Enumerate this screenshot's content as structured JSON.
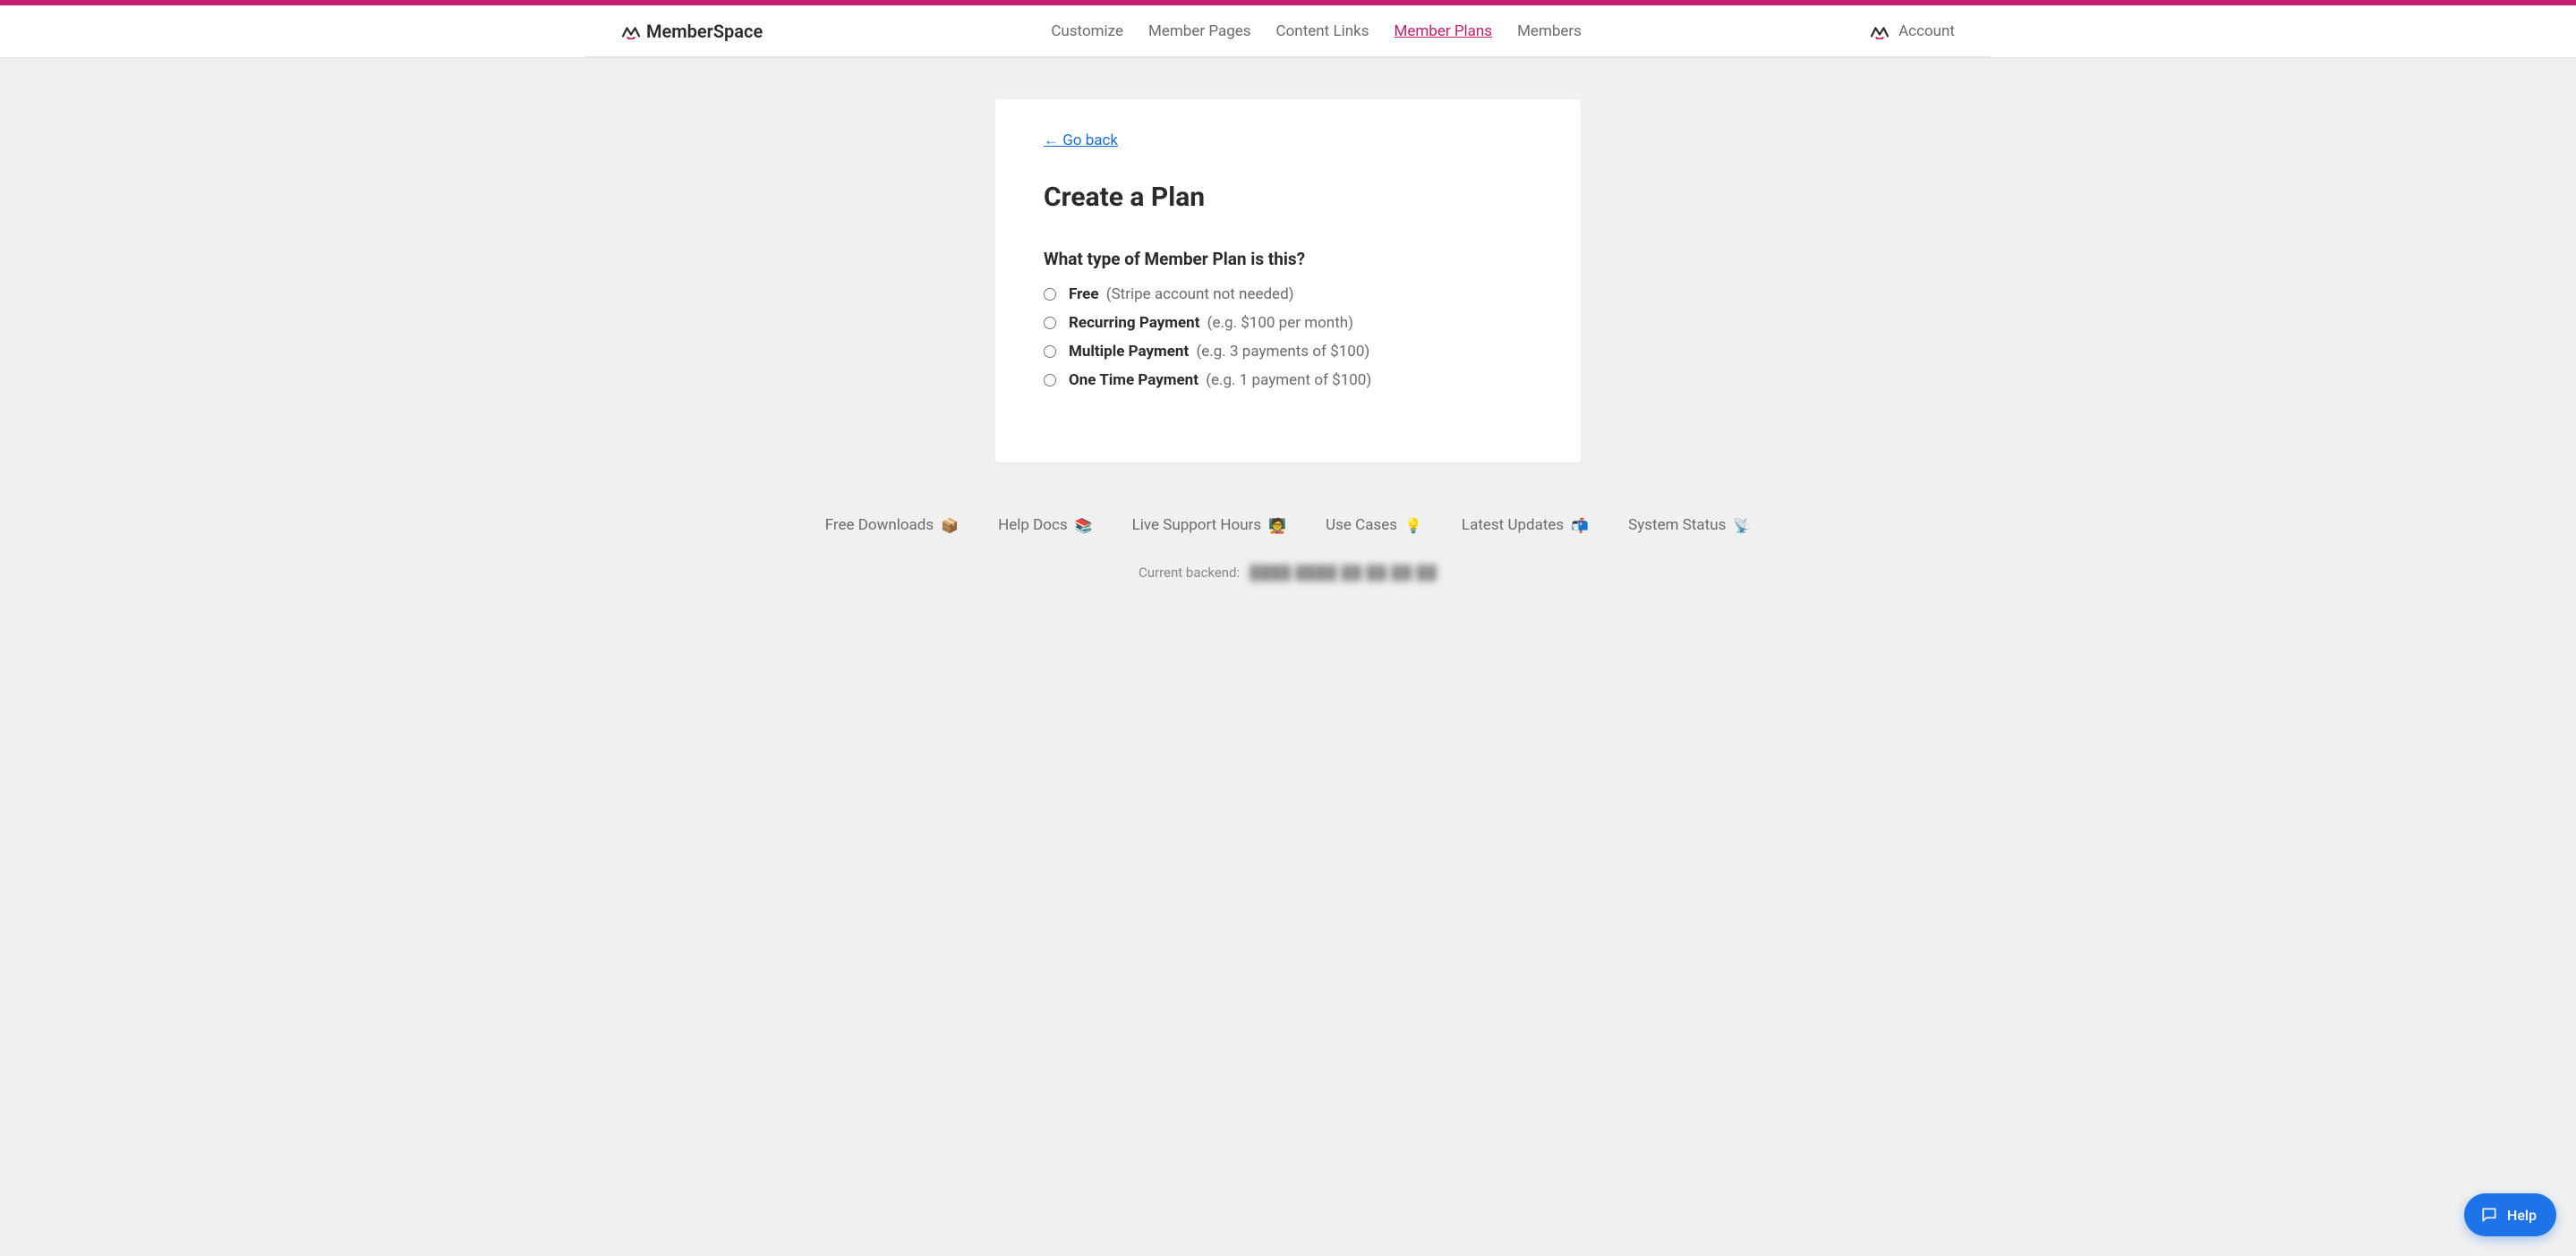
{
  "brand": "MemberSpace",
  "nav": {
    "customize": "Customize",
    "member_pages": "Member Pages",
    "content_links": "Content Links",
    "member_plans": "Member Plans",
    "members": "Members"
  },
  "account_label": "Account",
  "card": {
    "go_back": "← Go back",
    "title": "Create a Plan",
    "question": "What type of Member Plan is this?",
    "options": [
      {
        "title": "Free",
        "note": "(Stripe account not needed)"
      },
      {
        "title": "Recurring Payment",
        "note": "(e.g. $100 per month)"
      },
      {
        "title": "Multiple Payment",
        "note": "(e.g. 3 payments of $100)"
      },
      {
        "title": "One Time Payment",
        "note": "(e.g. 1 payment of $100)"
      }
    ]
  },
  "footer": {
    "free_downloads": "Free Downloads",
    "help_docs": "Help Docs",
    "live_support": "Live Support Hours",
    "use_cases": "Use Cases",
    "latest_updates": "Latest Updates",
    "system_status": "System Status",
    "backend_label": "Current backend:",
    "backend_value": "████ ████ ██ ██  ██ ██"
  },
  "help_widget": "Help"
}
